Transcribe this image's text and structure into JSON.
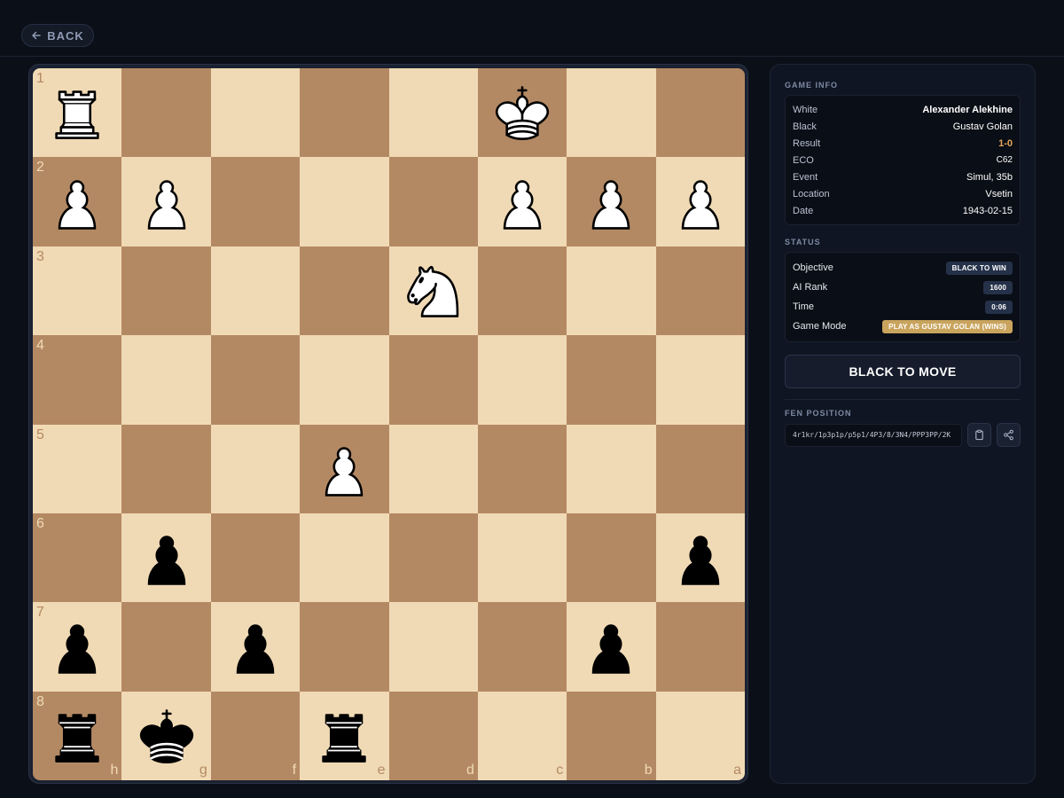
{
  "back_label": "BACK",
  "board": {
    "orientation": "black",
    "ranks": [
      "1",
      "2",
      "3",
      "4",
      "5",
      "6",
      "7",
      "8"
    ],
    "files": [
      "h",
      "g",
      "f",
      "e",
      "d",
      "c",
      "b",
      "a"
    ],
    "light_color": "#f0dab5",
    "dark_color": "#b38964",
    "squares": [
      [
        "wR",
        "",
        "",
        "",
        "",
        "wK",
        "",
        ""
      ],
      [
        "wP",
        "wP",
        "",
        "",
        "",
        "wP",
        "wP",
        "wP"
      ],
      [
        "",
        "",
        "",
        "",
        "wN",
        "",
        "",
        ""
      ],
      [
        "",
        "",
        "",
        "",
        "",
        "",
        "",
        ""
      ],
      [
        "",
        "",
        "",
        "wP",
        "",
        "",
        "",
        ""
      ],
      [
        "",
        "bP",
        "",
        "",
        "",
        "",
        "",
        "bP"
      ],
      [
        "bP",
        "",
        "bP",
        "",
        "",
        "",
        "bP",
        ""
      ],
      [
        "bR",
        "bK",
        "",
        "bR",
        "",
        "",
        "",
        ""
      ]
    ]
  },
  "game_info": {
    "title": "GAME INFO",
    "rows": [
      {
        "key": "White",
        "value": "Alexander Alekhine"
      },
      {
        "key": "Black",
        "value": "Gustav Golan"
      },
      {
        "key": "Result",
        "value": "1-0"
      },
      {
        "key": "ECO",
        "value": "C62"
      },
      {
        "key": "Event",
        "value": "Simul, 35b"
      },
      {
        "key": "Location",
        "value": "Vsetin"
      },
      {
        "key": "Date",
        "value": "1943-02-15"
      }
    ]
  },
  "status": {
    "title": "STATUS",
    "rows": [
      {
        "key": "Objective",
        "value": "BLACK TO WIN"
      },
      {
        "key": "AI Rank",
        "value": "1600"
      },
      {
        "key": "Time",
        "value": "0:06"
      },
      {
        "key": "Game Mode",
        "value": "PLAY AS GUSTAV GOLAN (WINS)"
      }
    ]
  },
  "move_button": "BLACK TO MOVE",
  "fen": {
    "title": "FEN POSITION",
    "value": "4r1kr/1p3p1p/p5p1/4P3/8/3N4/PPP3PP/2K"
  },
  "icons": {
    "back": "arrow-left-icon",
    "copy": "clipboard-icon",
    "share": "share-icon"
  },
  "colors": {
    "background": "#0b0f17",
    "panel": "#0f1522",
    "result": "#e2a65a",
    "game_mode_badge": "#c9a45d"
  }
}
